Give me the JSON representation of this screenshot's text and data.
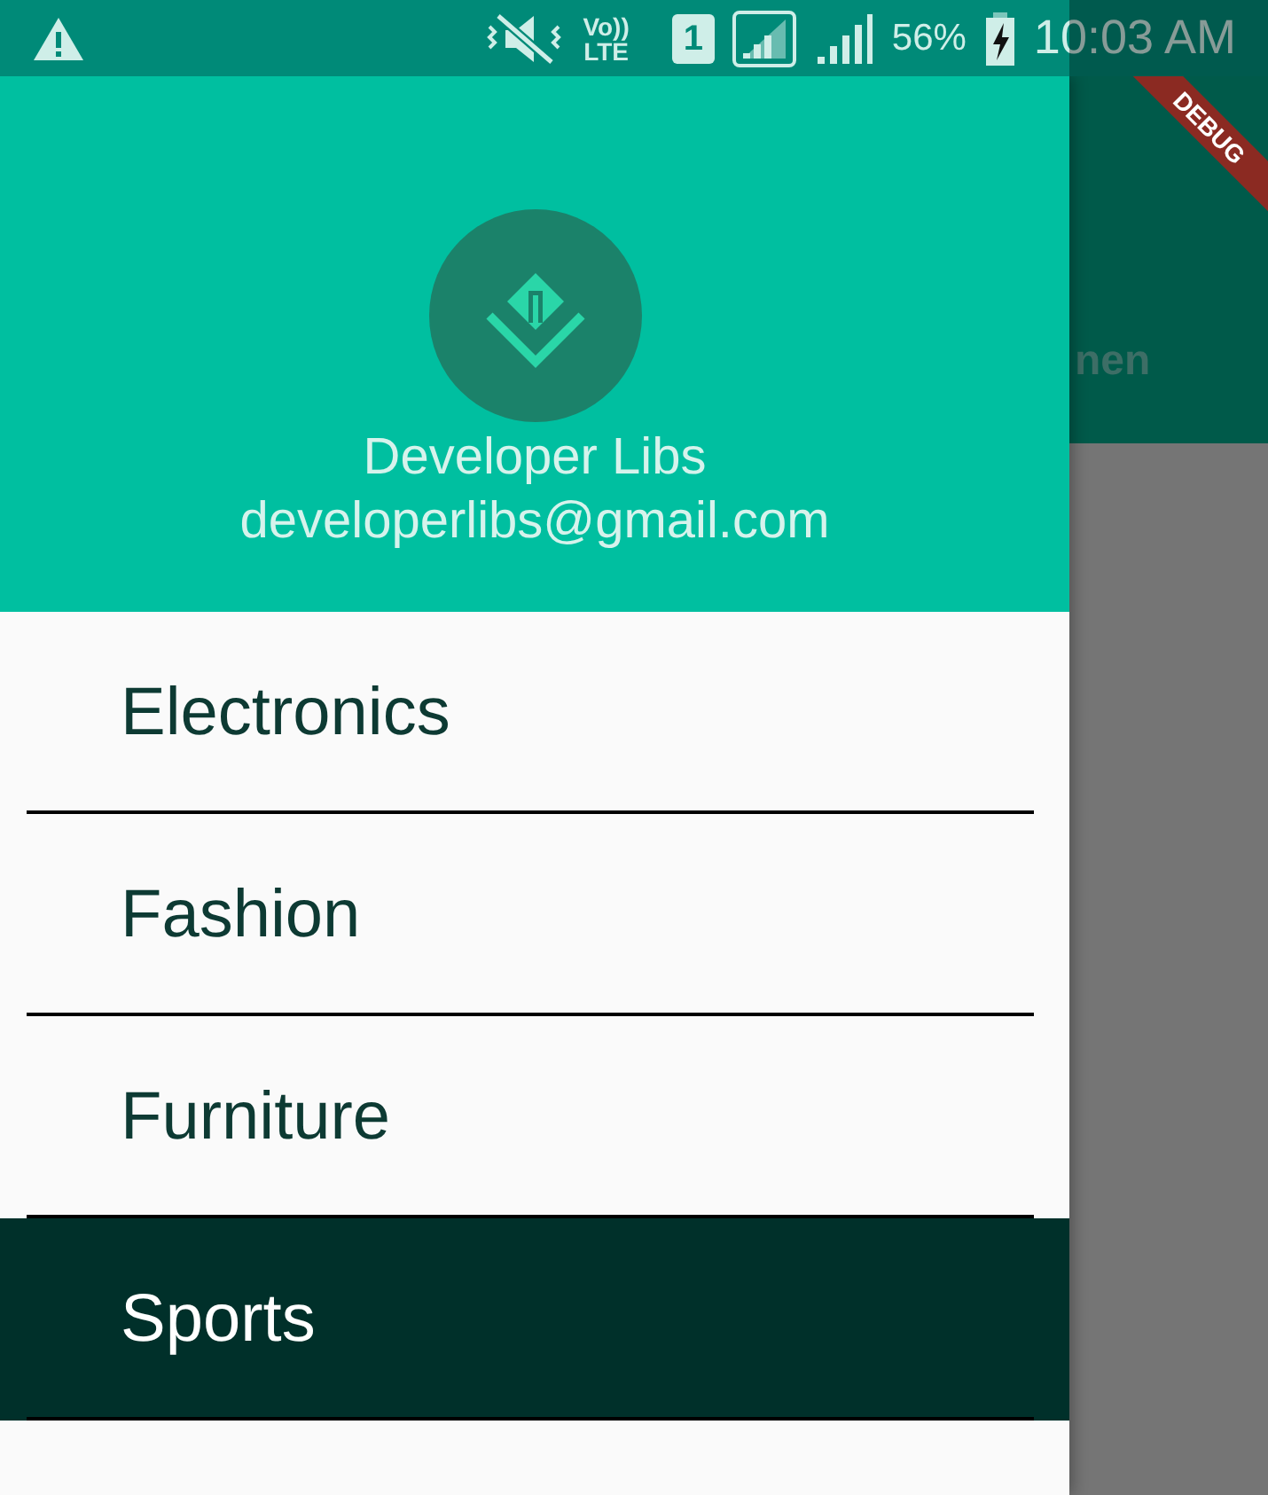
{
  "status_bar": {
    "volte": "Vo))",
    "lte": "LTE",
    "sim": "1",
    "battery_percent": "56%",
    "time": "10:03 AM"
  },
  "app_bar": {
    "title_fragment": "nen"
  },
  "debug_banner": "DEBUG",
  "drawer": {
    "header": {
      "name": "Developer Libs",
      "email": "developerlibs@gmail.com"
    },
    "items": [
      {
        "label": "Electronics",
        "selected": false
      },
      {
        "label": "Fashion",
        "selected": false
      },
      {
        "label": "Furniture",
        "selected": false
      },
      {
        "label": "Sports",
        "selected": true
      }
    ]
  }
}
